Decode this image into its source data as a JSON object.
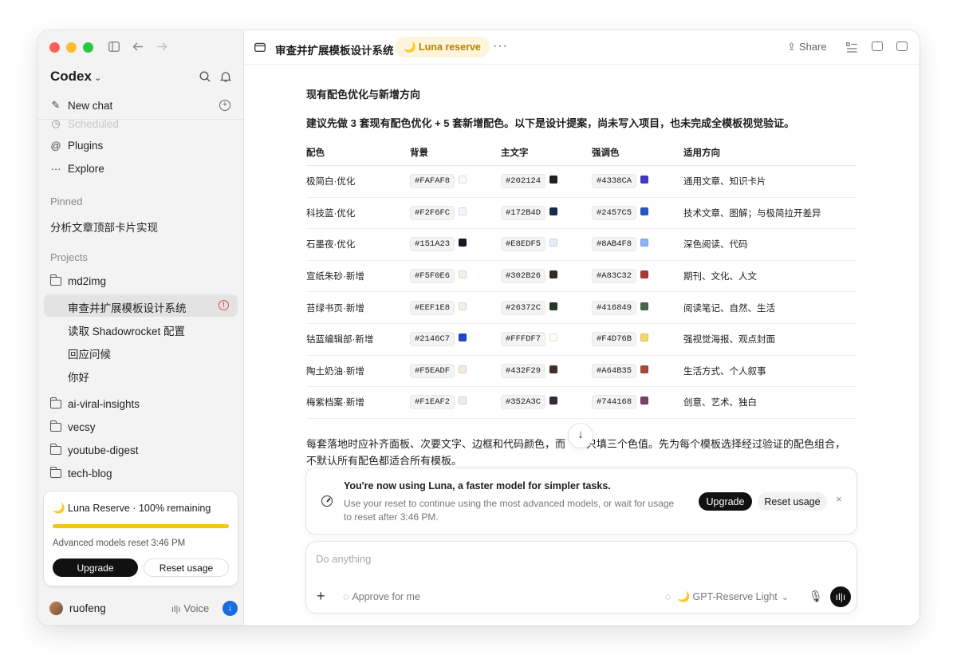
{
  "sidebar": {
    "brand": "Codex",
    "nav": [
      {
        "icon": "edit-icon",
        "label": "New chat"
      },
      {
        "icon": "clock-icon",
        "label": "Scheduled"
      },
      {
        "icon": "at-icon",
        "label": "Plugins"
      },
      {
        "icon": "dots-icon",
        "label": "Explore"
      }
    ],
    "pinned_label": "Pinned",
    "pinned": [
      "分析文章顶部卡片实现"
    ],
    "projects_label": "Projects",
    "project_main": "md2img",
    "threads": [
      "审查并扩展模板设计系统",
      "读取 Shadowrocket 配置",
      "回应问候",
      "你好"
    ],
    "projects": [
      "ai-viral-insights",
      "vecsy",
      "youtube-digest",
      "tech-blog"
    ],
    "usage_card": {
      "title": "🌙 Luna Reserve · 100% remaining",
      "progress": 1.0,
      "reset_text": "Advanced models reset 3:46 PM",
      "upgrade": "Upgrade",
      "reset_usage": "Reset usage"
    },
    "user": "ruofeng",
    "voice": "Voice"
  },
  "header": {
    "title": "审查并扩展模板设计系统",
    "badge": "🌙 Luna reserve",
    "more": "···",
    "share": "Share"
  },
  "content": {
    "heading": "现有配色优化与新增方向",
    "intro": "建议先做 3 套现有配色优化 + 5 套新增配色。以下是设计提案，尚未写入项目，也未完成全模板视觉验证。",
    "columns": [
      "配色",
      "背景",
      "主文字",
      "强调色",
      "适用方向"
    ],
    "rows": [
      {
        "name": "极简白·优化",
        "bg": "#FAFAF8",
        "fg": "#202124",
        "accent": "#4338CA",
        "use": "通用文章、知识卡片"
      },
      {
        "name": "科技蓝·优化",
        "bg": "#F2F6FC",
        "fg": "#172B4D",
        "accent": "#2457C5",
        "use": "技术文章、图解；与极简拉开差异"
      },
      {
        "name": "石墨夜·优化",
        "bg": "#151A23",
        "fg": "#E8EDF5",
        "accent": "#8AB4F8",
        "use": "深色阅读、代码"
      },
      {
        "name": "宣纸朱砂·新增",
        "bg": "#F5F0E6",
        "fg": "#302B26",
        "accent": "#A83C32",
        "use": "期刊、文化、人文"
      },
      {
        "name": "苔绿书页·新增",
        "bg": "#EEF1E8",
        "fg": "#26372C",
        "accent": "#416849",
        "use": "阅读笔记、自然、生活"
      },
      {
        "name": "钴蓝编辑部·新增",
        "bg": "#2146C7",
        "fg": "#FFFDF7",
        "accent": "#F4D76B",
        "use": "强视觉海报、观点封面"
      },
      {
        "name": "陶土奶油·新增",
        "bg": "#F5EADF",
        "fg": "#432F29",
        "accent": "#A64B35",
        "use": "生活方式、个人叙事"
      },
      {
        "name": "梅紫档案·新增",
        "bg": "#F1EAF2",
        "fg": "#352A3C",
        "accent": "#744168",
        "use": "创意、艺术、独白"
      }
    ],
    "para1": "每套落地时应补齐面板、次要文字、边框和代码颜色，而",
    "para2": "只填三个色值。先为每个模板选择经过验证的配色组合，",
    "para3": "不默认所有配色都适合所有模板。"
  },
  "notice": {
    "title": "You're now using Luna, a faster model for simpler tasks.",
    "body": "Use your reset to continue using the most advanced models, or wait for usage to reset after 3:46 PM.",
    "upgrade": "Upgrade",
    "reset_usage": "Reset usage",
    "close": "×"
  },
  "composer": {
    "placeholder": "Do anything",
    "approve": "Approve for me",
    "model": "🌙 GPT-Reserve Light"
  },
  "colors": {
    "accent_yellow": "#f2c80f",
    "badge_bg": "#fdf4dc",
    "badge_fg": "#b58300"
  }
}
